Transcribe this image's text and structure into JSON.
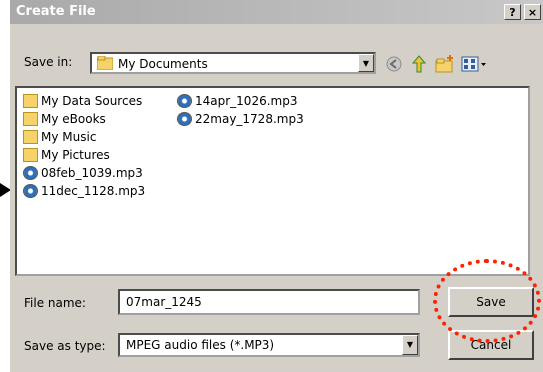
{
  "dialog": {
    "title": "Create File",
    "help_label": "?",
    "close_label": "×"
  },
  "toolbar": {
    "save_in_label": "Save in:",
    "location": "My Documents",
    "back_icon": "back-icon",
    "up_icon": "up-folder-icon",
    "new_folder_icon": "new-folder-icon",
    "views_icon": "views-menu-icon"
  },
  "files": [
    {
      "name": "My Data Sources",
      "type": "folder"
    },
    {
      "name": "My eBooks",
      "type": "folder"
    },
    {
      "name": "My Music",
      "type": "folder"
    },
    {
      "name": "My Pictures",
      "type": "folder"
    },
    {
      "name": "08feb_1039.mp3",
      "type": "mp3"
    },
    {
      "name": "11dec_1128.mp3",
      "type": "mp3"
    },
    {
      "name": "14apr_1026.mp3",
      "type": "mp3"
    },
    {
      "name": "22may_1728.mp3",
      "type": "mp3"
    }
  ],
  "form": {
    "file_name_label": "File name:",
    "file_name_value": "07mar_1245",
    "save_as_type_label": "Save as type:",
    "save_as_type_value": "MPEG audio files (*.MP3)"
  },
  "buttons": {
    "save": "Save",
    "cancel": "Cancel"
  },
  "colors": {
    "dialog_bg": "#d4d0c8",
    "titlebar": "#a9a9a9",
    "highlight_circle": "#ff2200"
  }
}
